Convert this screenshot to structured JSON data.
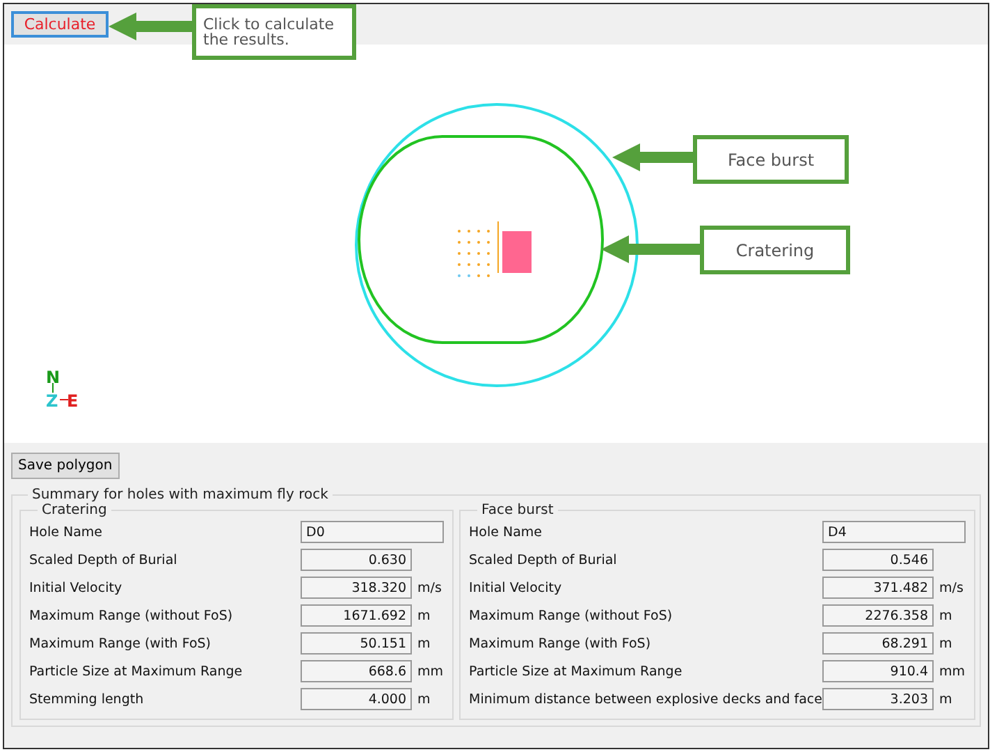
{
  "toolbar": {
    "calculate_button": "Calculate"
  },
  "compass": {
    "north": "N",
    "up": "Z",
    "east": "E"
  },
  "save_button": "Save polygon",
  "summary": {
    "title": "Summary for holes with maximum fly rock",
    "groups": [
      {
        "title": "Cratering",
        "rows": [
          {
            "label": "Hole Name",
            "value": "D0",
            "kind": "text"
          },
          {
            "label": "Scaled Depth of Burial",
            "value": "0.630",
            "kind": "number"
          },
          {
            "label": "Initial Velocity",
            "value": "318.320",
            "unit": "m/s",
            "kind": "number"
          },
          {
            "label": "Maximum Range (without FoS)",
            "value": "1671.692",
            "unit": "m",
            "kind": "number"
          },
          {
            "label": "Maximum Range (with FoS)",
            "value": "50.151",
            "unit": "m",
            "kind": "number"
          },
          {
            "label": "Particle Size at Maximum Range",
            "value": "668.6",
            "unit": "mm",
            "kind": "number"
          },
          {
            "label": "Stemming length",
            "value": "4.000",
            "unit": "m",
            "kind": "number"
          }
        ]
      },
      {
        "title": "Face burst",
        "rows": [
          {
            "label": "Hole Name",
            "value": "D4",
            "kind": "text"
          },
          {
            "label": "Scaled Depth of Burial",
            "value": "0.546",
            "kind": "number"
          },
          {
            "label": "Initial Velocity",
            "value": "371.482",
            "unit": "m/s",
            "kind": "number"
          },
          {
            "label": "Maximum Range (without FoS)",
            "value": "2276.358",
            "unit": "m",
            "kind": "number"
          },
          {
            "label": "Maximum Range (with FoS)",
            "value": "68.291",
            "unit": "m",
            "kind": "number"
          },
          {
            "label": "Particle Size at Maximum Range",
            "value": "910.4",
            "unit": "mm",
            "kind": "number"
          },
          {
            "label": "Minimum distance between explosive decks and face",
            "value": "3.203",
            "unit": "m",
            "kind": "number"
          }
        ]
      }
    ]
  },
  "callouts": [
    {
      "text": "Click to calculate the results."
    },
    {
      "text": "Face burst"
    },
    {
      "text": "Cratering"
    }
  ]
}
